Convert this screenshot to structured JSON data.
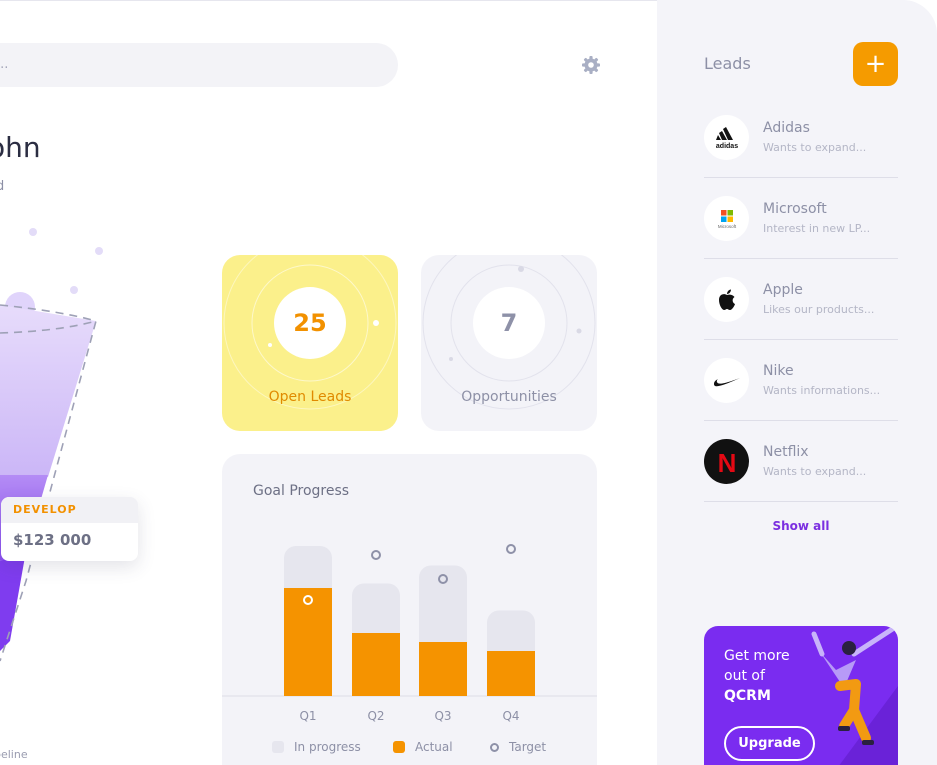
{
  "search": {
    "placeholder": "..."
  },
  "greeting": {
    "title": "ohn",
    "subtitle": "d"
  },
  "funnel": {
    "stage_label": "DEVELOP",
    "stage_value": "$123 000",
    "caption": "peline"
  },
  "stats": [
    {
      "value": "25",
      "label": "Open Leads"
    },
    {
      "value": "7",
      "label": "Opportunities"
    }
  ],
  "goal_progress": {
    "title": "Goal Progress",
    "legend": {
      "in_progress": "In progress",
      "actual": "Actual",
      "target": "Target"
    }
  },
  "chart_data": {
    "type": "bar",
    "title": "Goal Progress",
    "categories": [
      "Q1",
      "Q2",
      "Q3",
      "Q4"
    ],
    "series": [
      {
        "name": "In progress",
        "values": [
          100,
          75,
          87,
          57
        ]
      },
      {
        "name": "Actual",
        "values": [
          72,
          42,
          36,
          30
        ]
      },
      {
        "name": "Target",
        "values": [
          64,
          94,
          78,
          98
        ]
      }
    ],
    "ylim": [
      0,
      120
    ],
    "colors": {
      "in_progress": "#e6e6ee",
      "actual": "#f59300",
      "target": "#8e91a8"
    }
  },
  "leads": {
    "title": "Leads",
    "add_label": "+",
    "items": [
      {
        "name": "Adidas",
        "desc": "Wants to expand...",
        "logo_text": "adidas",
        "icon": "adidas-logo-icon"
      },
      {
        "name": "Microsoft",
        "desc": "Interest in new LP...",
        "logo_text": "Microsoft",
        "icon": "microsoft-logo-icon"
      },
      {
        "name": "Apple",
        "desc": "Likes our products...",
        "logo_text": "",
        "icon": "apple-logo-icon"
      },
      {
        "name": "Nike",
        "desc": "Wants informations...",
        "logo_text": "",
        "icon": "nike-logo-icon"
      },
      {
        "name": "Netflix",
        "desc": "Wants to expand...",
        "logo_text": "N",
        "icon": "netflix-logo-icon"
      }
    ],
    "show_all": "Show all"
  },
  "promo": {
    "line1": "Get more",
    "line2": "out of",
    "brand": "QCRM",
    "button": "Upgrade"
  },
  "colors": {
    "accent": "#f59b00",
    "brand_purple": "#7a2cf0",
    "leads_card": "#fbf08b"
  }
}
